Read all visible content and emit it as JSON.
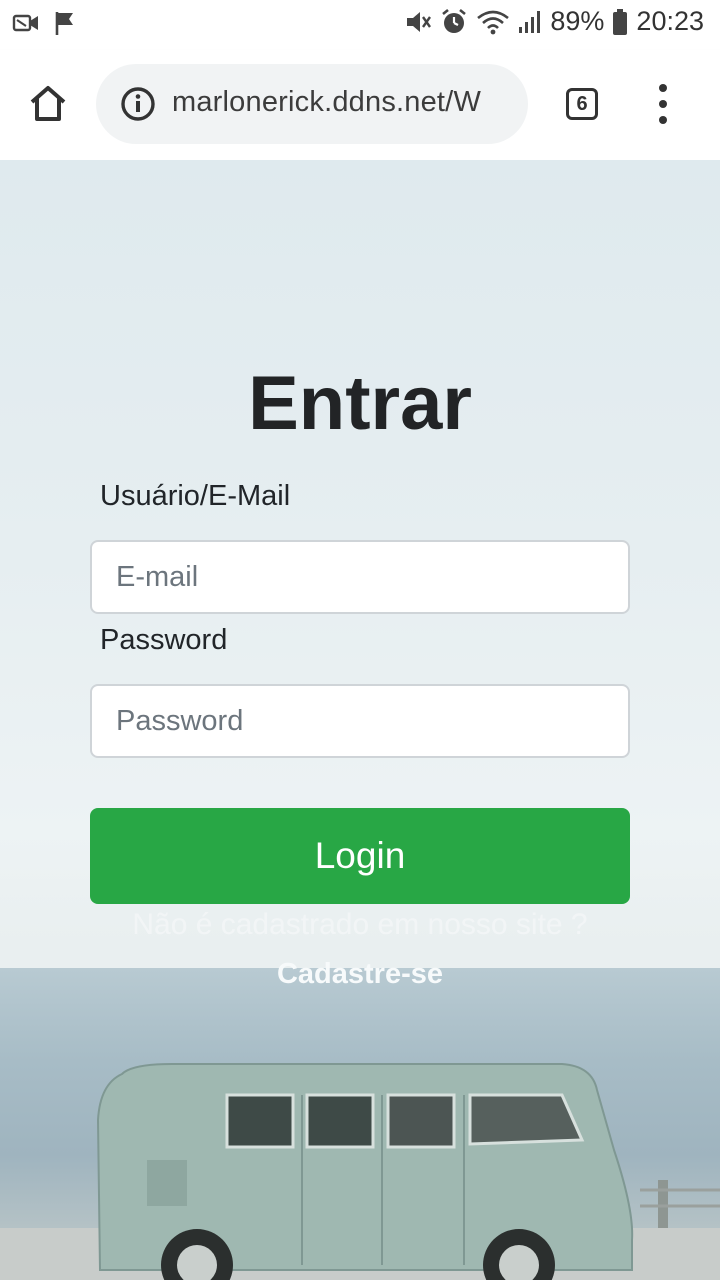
{
  "status_bar": {
    "battery": "89%",
    "time": "20:23",
    "icons": [
      "video-notification-icon",
      "flag-icon",
      "mute-icon",
      "alarm-icon",
      "wifi-icon",
      "signal-icon",
      "battery-icon"
    ]
  },
  "browser": {
    "url": "marlonerick.ddns.net/W",
    "tab_count": "6",
    "icons": [
      "home-icon",
      "info-icon",
      "tabs-icon",
      "more-menu-icon"
    ]
  },
  "login": {
    "title": "Entrar",
    "user_label": "Usuário/E-Mail",
    "email_placeholder": "E-mail",
    "email_value": "",
    "password_label": "Password",
    "password_placeholder": "Password",
    "password_value": "",
    "login_button": "Login",
    "register_prompt": "Não é cadastrado em nosso site ?",
    "register_link": "Cadastre-se"
  },
  "colors": {
    "primary_button": "#28a745",
    "title_text": "#222426",
    "browser_bg": "#ffffff",
    "url_pill_bg": "#f1f3f4"
  }
}
